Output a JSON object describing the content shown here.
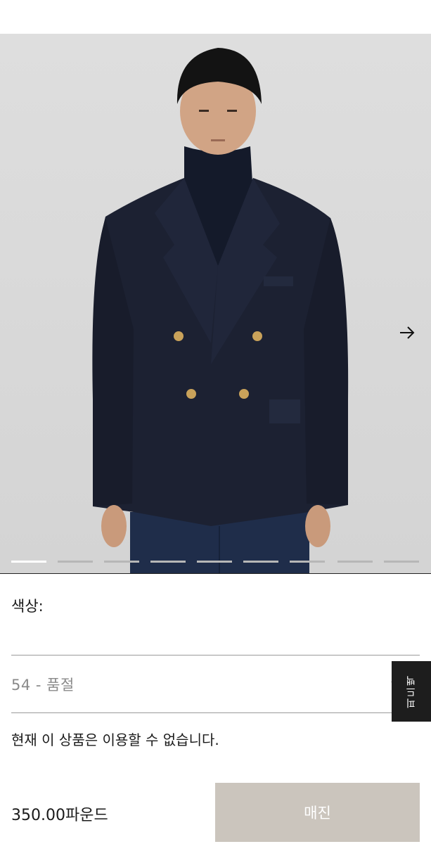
{
  "product": {
    "color_label": "색상:",
    "size_value": "54 - 품절",
    "availability": "현재 이 상품은 이용할 수 없습니다.",
    "price": "350.00파운드",
    "soldout_label": "매진",
    "feedback_label": "피드백"
  },
  "gallery": {
    "total_images": 9,
    "active_index": 1
  }
}
